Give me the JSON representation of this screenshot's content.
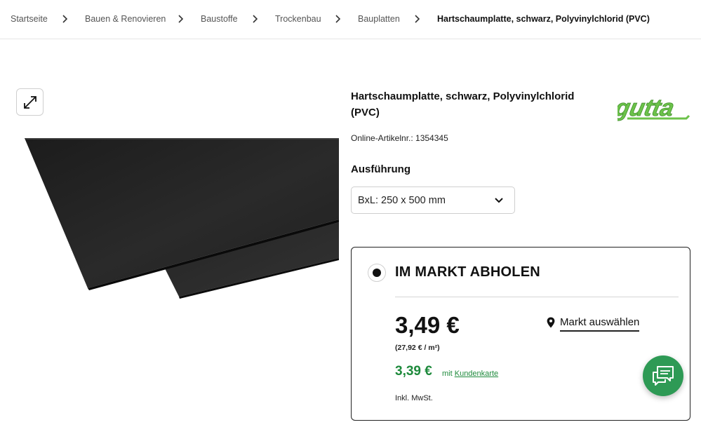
{
  "breadcrumb": {
    "items": [
      "Startseite",
      "Bauen & Renovieren",
      "Baustoffe",
      "Trockenbau",
      "Bauplatten"
    ],
    "current": "Hartschaumplatte, schwarz, Polyvinylchlorid (PVC)"
  },
  "gallery": {
    "zoom_icon": "expand-arrows-icon",
    "image_icon": "product-photo-black-pvc-sheets"
  },
  "product": {
    "title": "Hartschaumplatte, schwarz, Polyvinylchlorid (PVC)",
    "brand": "gutta",
    "article_number": "Online-Artikelnr.: 1354345"
  },
  "variant": {
    "label": "Ausführung",
    "selected": "BxL: 250 x 500 mm"
  },
  "pickup": {
    "title": "IM MARKT ABHOLEN",
    "price": "3,49 €",
    "unit_price": "(27,92 € / m²)",
    "card_price": "3,39 €",
    "card_prefix": "mit",
    "card_link": "Kundenkarte",
    "vat": "Inkl. MwSt.",
    "market_label": "Markt auswählen"
  },
  "colors": {
    "accent_green": "#1e8a3c",
    "brand_green": "#6cc24a",
    "chat_green": "#2e9a55"
  },
  "chat": {
    "icon": "chat-bubbles-icon"
  }
}
